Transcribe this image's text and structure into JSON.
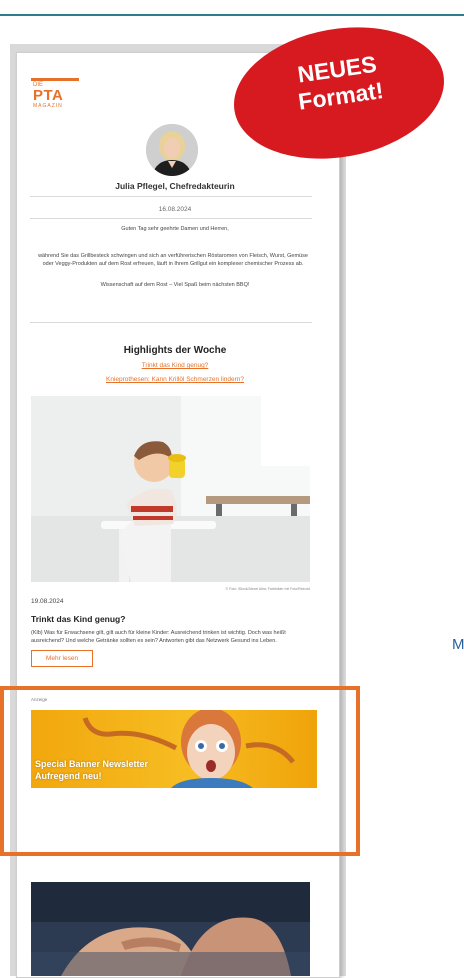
{
  "newsletter": {
    "logo": {
      "the": "DIE",
      "name": "PTA",
      "sub": "MAGAZIN"
    },
    "author": "Julia Pflegel, Chefredakteurin",
    "date": "16.08.2024",
    "greeting": "Guten Tag sehr geehrte Damen und Herren,",
    "intro": "während Sie das Grillbesteck schwingen und sich an verführerischen Röstaromen von Fleisch, Wurst, Gemüse oder Veggy-Produkten auf dem Rost erfreuen, läuft in Ihrem Grillgut ein komplexer chemischer Prozess ab.",
    "closing": "Wissenschaft auf dem Rost – Viel Spaß beim nächsten BBQ!",
    "highlights": {
      "title": "Highlights der Woche",
      "links": [
        "Trinkt das Kind genug?",
        "Knieprothesen: Kann Krillöl Schmerzen lindern?"
      ]
    },
    "article": {
      "image_credit": "© Foto: iStock/Alexei Alba; Farbbilder mit Foto/Reinold",
      "date": "19.08.2024",
      "title": "Trinkt das Kind genug?",
      "text": "(Klb) Was für Erwachsene gilt, gilt auch für kleine Kinder: Ausreichend trinken ist wichtig. Doch was heißt ausreichend? Und welche Getränke sollten es sein? Antworten gibt das Netzwerk Gesund ins Leben.",
      "more_label": "Mehr lesen"
    },
    "ad": {
      "label": "Anzeige",
      "banner_line1": "Special Banner Newsletter",
      "banner_line2": "Aufregend neu!"
    }
  },
  "badge": {
    "line1": "NEUES",
    "line2": "Format!"
  },
  "side_text": "M",
  "colors": {
    "accent": "#e8712a",
    "badge_red": "#d71920",
    "teal_line": "#2e7d8f",
    "side_text": "#2b5f9e"
  }
}
